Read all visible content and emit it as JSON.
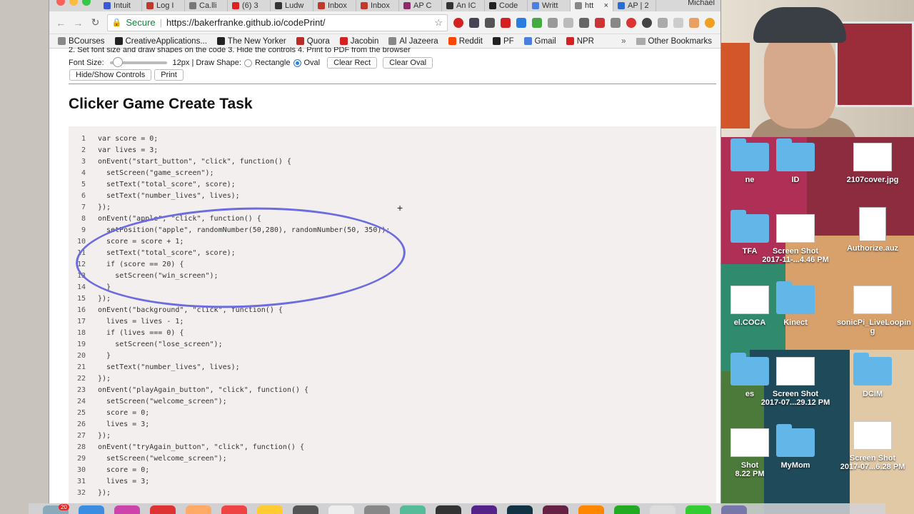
{
  "browser": {
    "profile_name": "Michael",
    "tabs": [
      {
        "label": "Intuit",
        "color": "#3a5bd9"
      },
      {
        "label": "Log I",
        "color": "#c0392b"
      },
      {
        "label": "Ca.lli",
        "color": "#777777"
      },
      {
        "label": "(6) 3",
        "color": "#e02020"
      },
      {
        "label": "Ludw",
        "color": "#333333"
      },
      {
        "label": "Inbox",
        "color": "#c0392b"
      },
      {
        "label": "Inbox",
        "color": "#c0392b"
      },
      {
        "label": "AP C",
        "color": "#8e2a6b"
      },
      {
        "label": "An IC",
        "color": "#333333"
      },
      {
        "label": "Code",
        "color": "#222222"
      },
      {
        "label": "Writt",
        "color": "#4a7ee0"
      },
      {
        "label": "htt",
        "color": "#888888"
      },
      {
        "label": "AP | 2",
        "color": "#2a6cd6"
      }
    ],
    "security_label": "Secure",
    "url": "https://bakerfranke.github.io/codePrint/",
    "bookmarks": [
      {
        "label": "BCourses",
        "color": "#888888"
      },
      {
        "label": "CreativeApplications...",
        "color": "#222222"
      },
      {
        "label": "The New Yorker",
        "color": "#222222"
      },
      {
        "label": "Quora",
        "color": "#b92b27"
      },
      {
        "label": "Jacobin",
        "color": "#d42020"
      },
      {
        "label": "Al Jazeera",
        "color": "#888888"
      },
      {
        "label": "Reddit",
        "color": "#ff4500"
      },
      {
        "label": "PF",
        "color": "#222222"
      },
      {
        "label": "Gmail",
        "color": "#4a7ee0"
      },
      {
        "label": "NPR",
        "color": "#d42020"
      }
    ],
    "other_bookmarks": "Other Bookmarks"
  },
  "page": {
    "instructions": "2. Set font size and draw shapes on the code 3. Hide the controls 4. Print to PDF from the browser",
    "font_size_label": "Font Size:",
    "font_size_value": "12px | Draw Shape:",
    "shape_rect": "Rectangle",
    "shape_oval": "Oval",
    "clear_rect": "Clear Rect",
    "clear_oval": "Clear Oval",
    "hide_show": "Hide/Show Controls",
    "print": "Print",
    "title": "Clicker Game Create Task"
  },
  "code_lines": [
    "var score = 0;",
    "var lives = 3;",
    "onEvent(\"start_button\", \"click\", function() {",
    "  setScreen(\"game_screen\");",
    "  setText(\"total_score\", score);",
    "  setText(\"number_lives\", lives);",
    "});",
    "onEvent(\"apple\", \"click\", function() {",
    "  setPosition(\"apple\", randomNumber(50,280), randomNumber(50, 350));",
    "  score = score + 1;",
    "  setText(\"total_score\", score);",
    "  if (score == 20) {",
    "    setScreen(\"win_screen\");",
    "  }",
    "});",
    "onEvent(\"background\", \"click\", function() {",
    "  lives = lives - 1;",
    "  if (lives === 0) {",
    "    setScreen(\"lose_screen\");",
    "  }",
    "  setText(\"number_lives\", lives);",
    "});",
    "onEvent(\"playAgain_button\", \"click\", function() {",
    "  setScreen(\"welcome_screen\");",
    "  score = 0;",
    "  lives = 3;",
    "});",
    "onEvent(\"tryAgain_button\", \"click\", function() {",
    "  setScreen(\"welcome_screen\");",
    "  score = 0;",
    "  lives = 3;",
    "});"
  ],
  "desktop_icons": [
    {
      "label": "ne",
      "kind": "folder"
    },
    {
      "label": "ID",
      "kind": "folder"
    },
    {
      "label": "2107cover.jpg",
      "kind": "thumb"
    },
    {
      "label": "TFA",
      "kind": "folder"
    },
    {
      "label": "Screen Shot",
      "sub": "2017-11-...4.46 PM",
      "kind": "thumb"
    },
    {
      "label": "Authorize.auz",
      "kind": "doc"
    },
    {
      "label": "el.COCA",
      "kind": "thumb"
    },
    {
      "label": "Kinect",
      "kind": "folder"
    },
    {
      "label": "sonicPi_LiveLoopin",
      "sub": "g",
      "kind": "thumb"
    },
    {
      "label": "es",
      "kind": "folder"
    },
    {
      "label": "Screen Shot",
      "sub": "2017-07...29.12 PM",
      "kind": "thumb"
    },
    {
      "label": "DCIM",
      "kind": "folder"
    },
    {
      "label": "Shot",
      "sub": "8.22 PM",
      "kind": "thumb"
    },
    {
      "label": "MyMom",
      "kind": "folder"
    },
    {
      "label": "Screen Shot",
      "sub": "2017-07...6.28 PM",
      "kind": "thumb"
    }
  ],
  "dock_badge": "20",
  "colors": {
    "oval_stroke": "#6c6ce0",
    "code_bg": "#f3efee",
    "secure_green": "#0a8a3a"
  }
}
